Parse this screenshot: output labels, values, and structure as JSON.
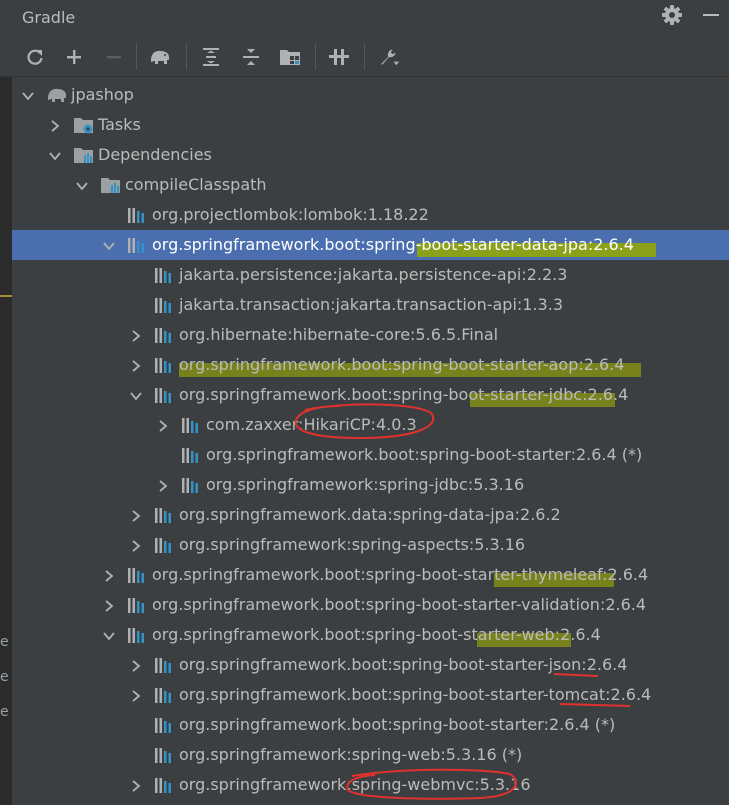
{
  "window": {
    "title": "Gradle"
  },
  "toolbar": {
    "buttons": [
      {
        "name": "reload-all-icon"
      },
      {
        "name": "add-icon"
      },
      {
        "name": "remove-icon"
      },
      {
        "name": "elephant-icon"
      },
      {
        "name": "expand-all-icon"
      },
      {
        "name": "collapse-all-icon"
      },
      {
        "name": "group-modules-icon"
      },
      {
        "name": "toggle-offline-icon"
      },
      {
        "name": "build-tool-settings-icon"
      }
    ]
  },
  "tree": {
    "rows": [
      {
        "label": "jpashop",
        "indent": 0,
        "arrow": "down",
        "icon": "elephant"
      },
      {
        "label": "Tasks",
        "indent": 1,
        "arrow": "right",
        "icon": "folder-gear"
      },
      {
        "label": "Dependencies",
        "indent": 1,
        "arrow": "down",
        "icon": "folder-lib"
      },
      {
        "label": "compileClasspath",
        "indent": 2,
        "arrow": "down",
        "icon": "folder-lib"
      },
      {
        "label": "org.projectlombok:lombok:1.18.22",
        "indent": 3,
        "arrow": "none",
        "icon": "library"
      },
      {
        "label": "org.springframework.boot:spring-boot-starter-data-jpa:2.6.4",
        "indent": 3,
        "arrow": "down",
        "icon": "library",
        "selected": true
      },
      {
        "label": "jakarta.persistence:jakarta.persistence-api:2.2.3",
        "indent": 4,
        "arrow": "none",
        "icon": "library"
      },
      {
        "label": "jakarta.transaction:jakarta.transaction-api:1.3.3",
        "indent": 4,
        "arrow": "none",
        "icon": "library"
      },
      {
        "label": "org.hibernate:hibernate-core:5.6.5.Final",
        "indent": 4,
        "arrow": "right",
        "icon": "library"
      },
      {
        "label": "org.springframework.boot:spring-boot-starter-aop:2.6.4",
        "indent": 4,
        "arrow": "right",
        "icon": "library"
      },
      {
        "label": "org.springframework.boot:spring-boot-starter-jdbc:2.6.4",
        "indent": 4,
        "arrow": "down",
        "icon": "library"
      },
      {
        "label": "com.zaxxer:HikariCP:4.0.3",
        "indent": 5,
        "arrow": "right",
        "icon": "library"
      },
      {
        "label": "org.springframework.boot:spring-boot-starter:2.6.4 (*)",
        "indent": 5,
        "arrow": "none",
        "icon": "library"
      },
      {
        "label": "org.springframework:spring-jdbc:5.3.16",
        "indent": 5,
        "arrow": "right",
        "icon": "library"
      },
      {
        "label": "org.springframework.data:spring-data-jpa:2.6.2",
        "indent": 4,
        "arrow": "right",
        "icon": "library"
      },
      {
        "label": "org.springframework:spring-aspects:5.3.16",
        "indent": 4,
        "arrow": "right",
        "icon": "library"
      },
      {
        "label": "org.springframework.boot:spring-boot-starter-thymeleaf:2.6.4",
        "indent": 3,
        "arrow": "right",
        "icon": "library"
      },
      {
        "label": "org.springframework.boot:spring-boot-starter-validation:2.6.4",
        "indent": 3,
        "arrow": "right",
        "icon": "library"
      },
      {
        "label": "org.springframework.boot:spring-boot-starter-web:2.6.4",
        "indent": 3,
        "arrow": "down",
        "icon": "library"
      },
      {
        "label": "org.springframework.boot:spring-boot-starter-json:2.6.4",
        "indent": 4,
        "arrow": "right",
        "icon": "library"
      },
      {
        "label": "org.springframework.boot:spring-boot-starter-tomcat:2.6.4",
        "indent": 4,
        "arrow": "right",
        "icon": "library"
      },
      {
        "label": "org.springframework.boot:spring-boot-starter:2.6.4 (*)",
        "indent": 4,
        "arrow": "none",
        "icon": "library"
      },
      {
        "label": "org.springframework:spring-web:5.3.16 (*)",
        "indent": 4,
        "arrow": "none",
        "icon": "library"
      },
      {
        "label": "org.springframework:spring-webmvc:5.3.16",
        "indent": 4,
        "arrow": "right",
        "icon": "library"
      }
    ]
  },
  "left_fragments": [
    "e",
    "e",
    "e"
  ],
  "colors": {
    "selection": "#4b6eaf",
    "panel": "#3c3f41",
    "text": "#bbbbbb",
    "highlight": "#a5b300",
    "red_annotation": "#e0322c"
  }
}
